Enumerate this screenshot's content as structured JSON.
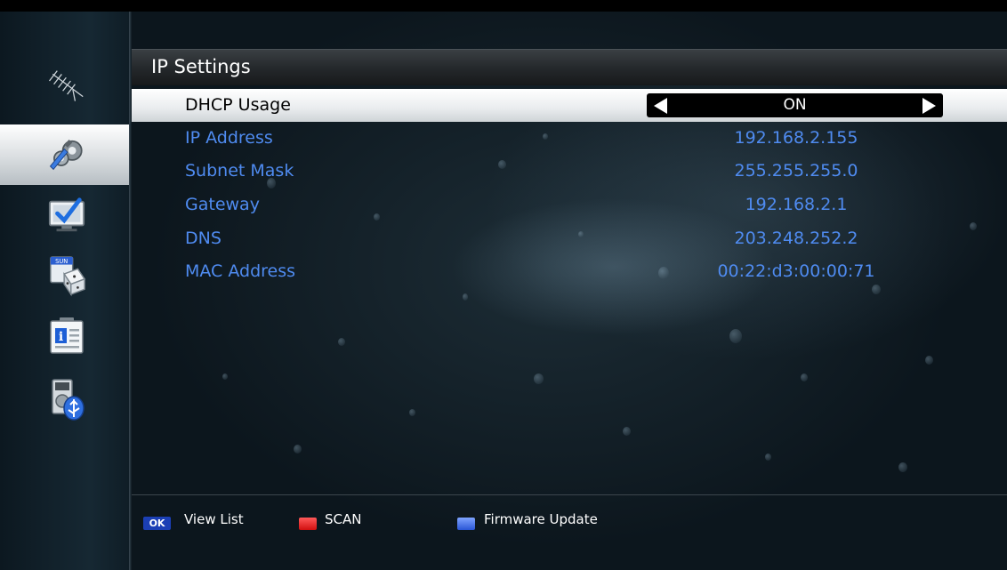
{
  "section": {
    "title": "IP Settings"
  },
  "dhcp": {
    "label": "DHCP Usage",
    "value": "ON"
  },
  "network_rows": [
    {
      "label": "IP Address",
      "value": "192.168.2.155"
    },
    {
      "label": "Subnet Mask",
      "value": "255.255.255.0"
    },
    {
      "label": "Gateway",
      "value": "192.168.2.1"
    },
    {
      "label": "DNS",
      "value": "203.248.252.2"
    },
    {
      "label": "MAC Address",
      "value": "00:22:d3:00:00:71"
    }
  ],
  "sidebar": {
    "items": [
      {
        "icon": "antenna-icon",
        "selected": false
      },
      {
        "icon": "settings-gears-icon",
        "selected": true
      },
      {
        "icon": "tv-check-icon",
        "selected": false
      },
      {
        "icon": "calendar-dice-icon",
        "badge": "SUN",
        "selected": false
      },
      {
        "icon": "info-card-icon",
        "badge": "i",
        "selected": false
      },
      {
        "icon": "usb-device-icon",
        "selected": false
      }
    ]
  },
  "footer": {
    "ok_badge": "OK",
    "view_list_label": "View List",
    "scan_label": "SCAN",
    "firmware_label": "Firmware Update"
  },
  "colors": {
    "accent_blue": "#4f8bf0",
    "red_key": "#e01818",
    "blue_key": "#3a64e0",
    "ok_badge": "#1b3fb5"
  }
}
